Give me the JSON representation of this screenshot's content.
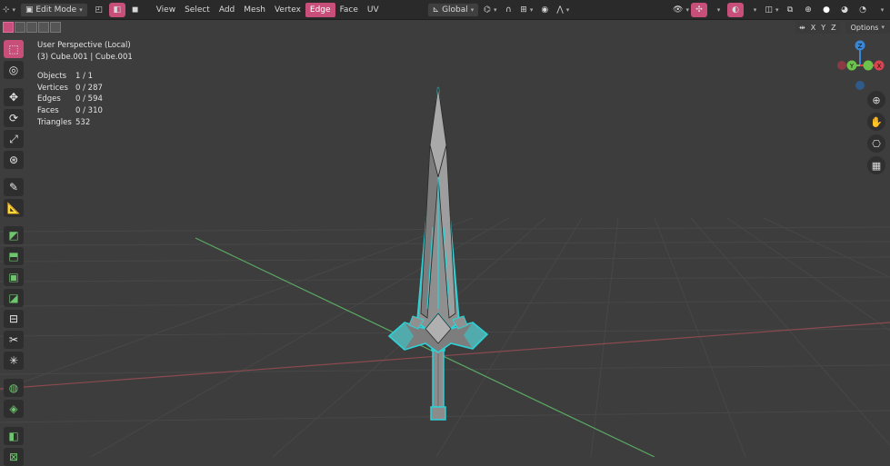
{
  "header": {
    "mode": "Edit Mode",
    "menus": [
      "View",
      "Select",
      "Add",
      "Mesh",
      "Vertex",
      "Edge",
      "Face",
      "UV"
    ],
    "active_menu": "Edge",
    "orientation": "Global"
  },
  "subbar": {
    "axes": [
      "X",
      "Y",
      "Z"
    ],
    "options": "Options"
  },
  "overlay": {
    "perspective": "User Perspective (Local)",
    "object": "(3) Cube.001 | Cube.001"
  },
  "stats": [
    {
      "label": "Objects",
      "value": "1 / 1"
    },
    {
      "label": "Vertices",
      "value": "0 / 287"
    },
    {
      "label": "Edges",
      "value": "0 / 594"
    },
    {
      "label": "Faces",
      "value": "0 / 310"
    },
    {
      "label": "Triangles",
      "value": "532"
    }
  ],
  "gizmo": {
    "x": "X",
    "y": "Y",
    "z": "Z"
  },
  "colors": {
    "accent": "#c74f7a",
    "selection": "#2ed2d6",
    "x_axis": "#d9434f",
    "y_axis": "#6cc24a",
    "z_axis": "#3a86d6"
  }
}
